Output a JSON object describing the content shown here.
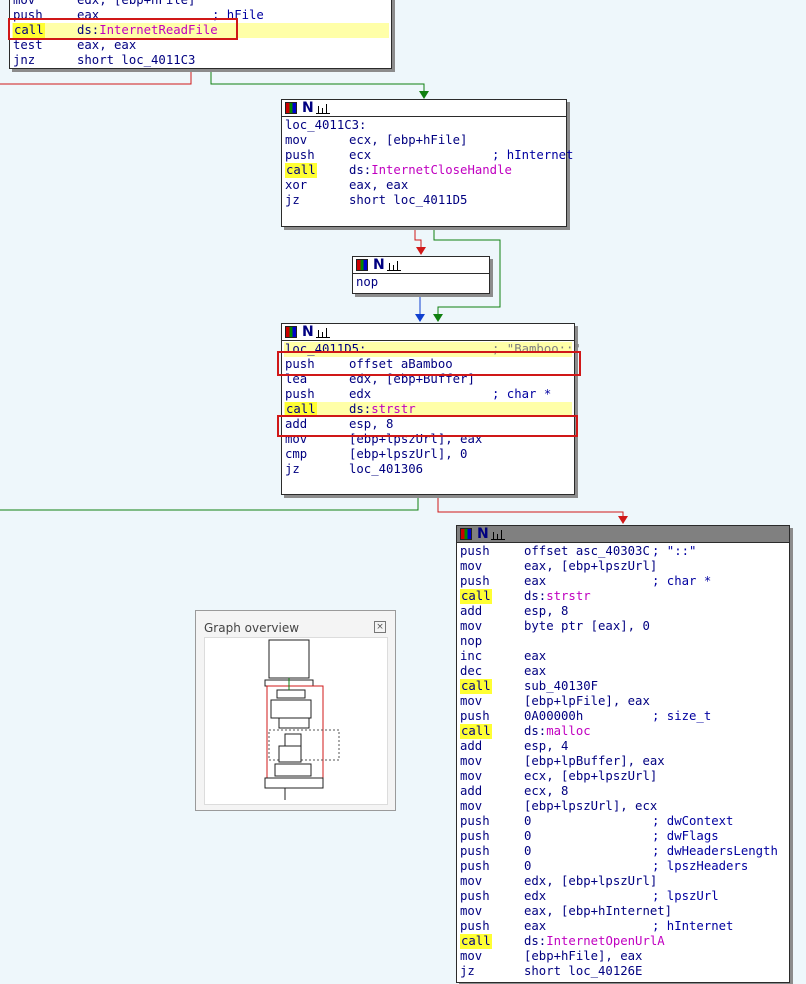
{
  "colors": {
    "background": "#eef7fb",
    "call_highlight": "#ffff33",
    "mnemonic": "#000080",
    "api": "#c000c0",
    "number": "#008000",
    "edge_red": "#d01818",
    "edge_green": "#108010",
    "edge_blue": "#1040d0"
  },
  "node_icons": [
    "grid-icon",
    "node-n-icon",
    "bar-graph-icon"
  ],
  "nodes": {
    "top": {
      "lines": [
        {
          "op": "mov",
          "args": "edx, [ebp+hFile]"
        },
        {
          "op": "push",
          "args": "eax",
          "cmt": "; hFile"
        },
        {
          "op": "call",
          "args": "ds:",
          "api": "InternetReadFile"
        },
        {
          "op": "test",
          "args": "eax, eax"
        },
        {
          "op": "jnz",
          "args": "short loc_4011C3"
        }
      ]
    },
    "n2": {
      "lines": [
        {
          "label": "loc_4011C3:"
        },
        {
          "op": "mov",
          "args": "ecx, [ebp+hFile]"
        },
        {
          "op": "push",
          "args": "ecx",
          "cmt": "; hInternet"
        },
        {
          "op": "call",
          "args": "ds:",
          "api": "InternetCloseHandle"
        },
        {
          "op": "xor",
          "args": "eax, eax"
        },
        {
          "op": "jz",
          "args": "short loc_4011D5"
        }
      ]
    },
    "n3": {
      "lines": [
        {
          "op": "nop",
          "args": ""
        }
      ]
    },
    "n4": {
      "lines": [
        {
          "label": "loc_4011D5:",
          "cmt": "; \"Bamboo::\""
        },
        {
          "op": "push",
          "args": "offset aBamboo"
        },
        {
          "op": "lea",
          "args": "edx, [ebp+Buffer]"
        },
        {
          "op": "push",
          "args": "edx",
          "cmt": "; char *"
        },
        {
          "op": "call",
          "args": "ds:",
          "api": "strstr"
        },
        {
          "op": "add",
          "args": "esp, 8"
        },
        {
          "op": "mov",
          "args": "[ebp+lpszUrl], eax"
        },
        {
          "op": "cmp",
          "args": "[ebp+lpszUrl], 0"
        },
        {
          "op": "jz",
          "args": "loc_401306"
        }
      ]
    },
    "n5": {
      "lines": [
        {
          "op": "push",
          "args": "offset asc_40303C",
          "cmt": "; \"::\""
        },
        {
          "op": "mov",
          "args": "eax, [ebp+lpszUrl]"
        },
        {
          "op": "push",
          "args": "eax",
          "cmt": "; char *"
        },
        {
          "op": "call",
          "args": "ds:",
          "api": "strstr"
        },
        {
          "op": "add",
          "args": "esp, 8"
        },
        {
          "op": "mov",
          "args": "byte ptr [eax], 0"
        },
        {
          "op": "nop",
          "args": ""
        },
        {
          "op": "inc",
          "args": "eax"
        },
        {
          "op": "dec",
          "args": "eax"
        },
        {
          "op": "call",
          "args": "sub_40130F"
        },
        {
          "op": "mov",
          "args": "[ebp+lpFile], eax"
        },
        {
          "op": "push",
          "args": "0A00000h",
          "cmt": "; size_t"
        },
        {
          "op": "call",
          "args": "ds:",
          "api": "malloc"
        },
        {
          "op": "add",
          "args": "esp, 4"
        },
        {
          "op": "mov",
          "args": "[ebp+lpBuffer], eax"
        },
        {
          "op": "mov",
          "args": "ecx, [ebp+lpszUrl]"
        },
        {
          "op": "add",
          "args": "ecx, 8"
        },
        {
          "op": "mov",
          "args": "[ebp+lpszUrl], ecx"
        },
        {
          "op": "push",
          "args": "0",
          "cmt": "; dwContext"
        },
        {
          "op": "push",
          "args": "0",
          "cmt": "; dwFlags"
        },
        {
          "op": "push",
          "args": "0",
          "cmt": "; dwHeadersLength"
        },
        {
          "op": "push",
          "args": "0",
          "cmt": "; lpszHeaders"
        },
        {
          "op": "mov",
          "args": "edx, [ebp+lpszUrl]"
        },
        {
          "op": "push",
          "args": "edx",
          "cmt": "; lpszUrl"
        },
        {
          "op": "mov",
          "args": "eax, [ebp+hInternet]"
        },
        {
          "op": "push",
          "args": "eax",
          "cmt": "; hInternet"
        },
        {
          "op": "call",
          "args": "ds:",
          "api": "InternetOpenUrlA"
        },
        {
          "op": "mov",
          "args": "[ebp+hFile], eax"
        },
        {
          "op": "jz",
          "args": "short loc_40126E"
        }
      ]
    }
  },
  "overview": {
    "title": "Graph overview",
    "close_icon": "close-icon"
  }
}
